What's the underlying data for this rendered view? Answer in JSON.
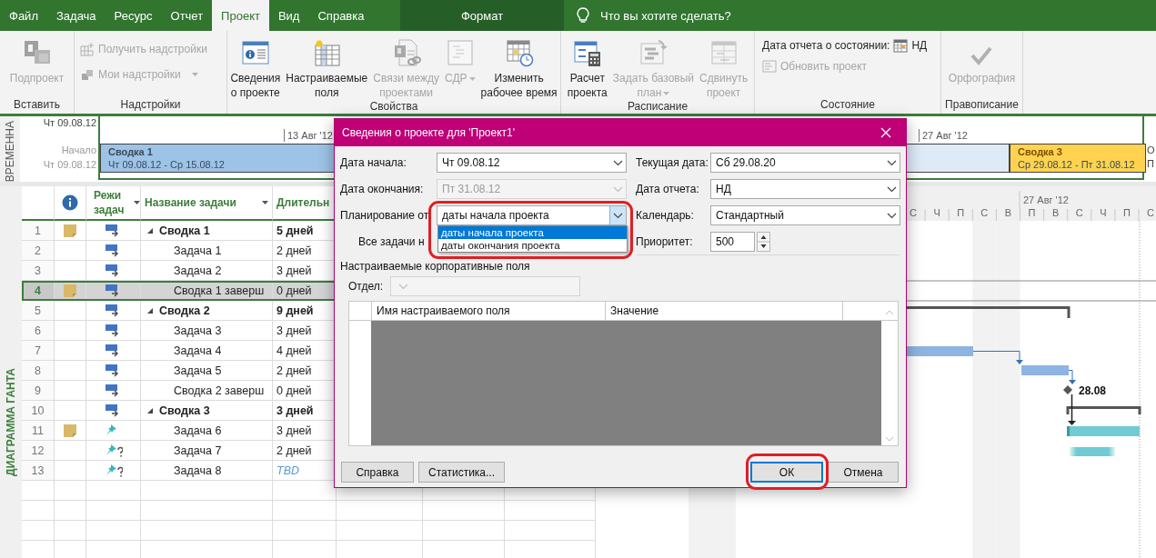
{
  "tabs": [
    {
      "label": "Файл",
      "selected": false
    },
    {
      "label": "Задача",
      "selected": false
    },
    {
      "label": "Ресурс",
      "selected": false
    },
    {
      "label": "Отчет",
      "selected": false
    },
    {
      "label": "Проект",
      "selected": true
    },
    {
      "label": "Вид",
      "selected": false
    },
    {
      "label": "Справка",
      "selected": false
    }
  ],
  "context_tab": {
    "label": "Формат"
  },
  "tell_me": {
    "placeholder": "Что вы хотите сделать?"
  },
  "ribbon": {
    "groups": [
      {
        "label": "Вставить",
        "items": [
          {
            "kind": "large",
            "label": "Подпроект",
            "disabled": true,
            "dropdown": false
          }
        ]
      },
      {
        "label": "Надстройки",
        "items": [
          {
            "kind": "small",
            "label": "Получить надстройки",
            "disabled": true,
            "dropdown": false
          },
          {
            "kind": "small",
            "label": "Мои надстройки",
            "disabled": true,
            "dropdown": true
          }
        ]
      },
      {
        "label": "Свойства",
        "items": [
          {
            "kind": "large",
            "label": "Сведения\nо проекте",
            "disabled": false,
            "dropdown": false
          },
          {
            "kind": "large",
            "label": "Настраиваемые\nполя",
            "disabled": false,
            "dropdown": false
          },
          {
            "kind": "large",
            "label": "Связи между\nпроектами",
            "disabled": true,
            "dropdown": false
          },
          {
            "kind": "large",
            "label": "СДР",
            "disabled": true,
            "dropdown": true
          },
          {
            "kind": "large",
            "label": "Изменить\nрабочее время",
            "disabled": false,
            "dropdown": false
          }
        ]
      },
      {
        "label": "Расписание",
        "items": [
          {
            "kind": "large",
            "label": "Расчет\nпроекта",
            "disabled": false,
            "dropdown": false
          },
          {
            "kind": "large",
            "label": "Задать базовый\nплан",
            "disabled": true,
            "dropdown": true
          },
          {
            "kind": "large",
            "label": "Сдвинуть\nпроект",
            "disabled": true,
            "dropdown": false
          }
        ]
      },
      {
        "label": "Состояние",
        "items": [
          {
            "kind": "status",
            "label": "Дата отчета о состоянии:",
            "value": "НД",
            "disabled": false,
            "dropdown": false
          },
          {
            "kind": "small",
            "label": "Обновить проект",
            "disabled": true,
            "dropdown": false
          }
        ]
      },
      {
        "label": "Правописание",
        "items": [
          {
            "kind": "large",
            "label": "Орфография",
            "disabled": true,
            "dropdown": false
          }
        ]
      }
    ]
  },
  "timeline": {
    "label": "ВРЕМЕННА",
    "top_date": "Чт 09.08.12",
    "start_caption": "Начало",
    "start_value": "Чт 09.08.12",
    "ticks": [
      "13 Авг '12",
      "27 Авг '12"
    ],
    "bars": [
      {
        "name": "Сводка 1",
        "dates": "Чт 09.08.12 - Ср 15.08.12",
        "color": "#9dc3e6"
      },
      {
        "color": "#deebf7"
      },
      {
        "name": "Сводка 3",
        "dates": "Ср 29.08.12 - Пт 31.08.12",
        "color": "#ffd34f"
      }
    ],
    "finish_caption": "О",
    "finish_value": "П"
  },
  "view_label": "ДИАГРАММА ГАНТА",
  "table": {
    "columns": [
      "Режи задач",
      "Название задачи",
      "Длительн"
    ],
    "rows": [
      {
        "num": "1",
        "name": "Сводка 1",
        "duration": "5 дней",
        "summary": true,
        "manual": false,
        "estimated": false,
        "note": true,
        "selected": false,
        "expanded": true,
        "tbd": false,
        "children": [
          {
            "num": "2",
            "name": "Задача 1",
            "duration": "2 дней",
            "summary": false,
            "manual": false,
            "estimated": false,
            "note": false,
            "selected": false,
            "tbd": false
          },
          {
            "num": "3",
            "name": "Задача 2",
            "duration": "3 дней",
            "summary": false,
            "manual": false,
            "estimated": false,
            "note": false,
            "selected": false,
            "tbd": false
          },
          {
            "num": "4",
            "name": "Сводка 1 заверш",
            "duration": "0 дней",
            "summary": false,
            "manual": false,
            "estimated": false,
            "note": true,
            "selected": true,
            "tbd": false
          }
        ]
      },
      {
        "num": "5",
        "name": "Сводка 2",
        "duration": "9 дней",
        "summary": true,
        "manual": false,
        "estimated": false,
        "note": false,
        "selected": false,
        "expanded": true,
        "tbd": false,
        "children": [
          {
            "num": "6",
            "name": "Задача 3",
            "duration": "3 дней",
            "summary": false,
            "manual": false,
            "estimated": false,
            "note": false,
            "selected": false,
            "tbd": false
          },
          {
            "num": "7",
            "name": "Задача 4",
            "duration": "4 дней",
            "summary": false,
            "manual": false,
            "estimated": false,
            "note": false,
            "selected": false,
            "tbd": false
          },
          {
            "num": "8",
            "name": "Задача 5",
            "duration": "2 дней",
            "summary": false,
            "manual": false,
            "estimated": false,
            "note": false,
            "selected": false,
            "tbd": false
          },
          {
            "num": "9",
            "name": "Сводка 2 заверш",
            "duration": "0 дней",
            "summary": false,
            "manual": false,
            "estimated": false,
            "note": false,
            "selected": false,
            "tbd": false
          }
        ]
      },
      {
        "num": "10",
        "name": "Сводка 3",
        "duration": "3 дней",
        "summary": true,
        "manual": false,
        "estimated": false,
        "note": false,
        "selected": false,
        "expanded": true,
        "tbd": false,
        "children": [
          {
            "num": "11",
            "name": "Задача 6",
            "duration": "3 дней",
            "summary": false,
            "manual": true,
            "estimated": false,
            "note": true,
            "selected": false,
            "tbd": false
          },
          {
            "num": "12",
            "name": "Задача 7",
            "duration": "2 дней",
            "summary": false,
            "manual": true,
            "estimated": true,
            "note": false,
            "selected": false,
            "tbd": false
          },
          {
            "num": "13",
            "name": "Задача 8",
            "duration": "TBD",
            "summary": false,
            "manual": true,
            "estimated": true,
            "note": false,
            "selected": false,
            "tbd": true
          }
        ]
      }
    ]
  },
  "gantt": {
    "month": "27 Авг '12",
    "days": [
      {
        "label": "С",
        "weekend": false
      },
      {
        "label": "Ч",
        "weekend": false
      },
      {
        "label": "П",
        "weekend": false
      },
      {
        "label": "С",
        "weekend": true
      },
      {
        "label": "В",
        "weekend": true
      },
      {
        "label": "П",
        "weekend": false
      },
      {
        "label": "В",
        "weekend": false
      },
      {
        "label": "С",
        "weekend": false
      },
      {
        "label": "Ч",
        "weekend": false
      },
      {
        "label": "П",
        "weekend": false
      },
      {
        "label": "С",
        "weekend": false
      }
    ],
    "milestone_label": "28.08"
  },
  "dialog": {
    "title": "Сведения о проекте для 'Проект1'",
    "left_fields": [
      {
        "label": "Дата начала:",
        "value": "Чт 09.08.12",
        "disabled": false,
        "expanded": false,
        "highlighted": false
      },
      {
        "label": "Дата окончания:",
        "value": "Пт 31.08.12",
        "disabled": true,
        "expanded": false,
        "highlighted": false
      },
      {
        "label": "Планирование от",
        "value": "даты начала проекта",
        "disabled": false,
        "expanded": true,
        "highlighted": true
      }
    ],
    "right_fields": [
      {
        "label": "Текущая дата:",
        "value": "Сб 29.08.20"
      },
      {
        "label": "Дата отчета:",
        "value": "НД"
      },
      {
        "label": "Календарь:",
        "value": "Стандартный"
      }
    ],
    "dropdown_options": [
      {
        "label": "даты начала проекта",
        "selected": true
      },
      {
        "label": "даты окончания проекта",
        "selected": false
      }
    ],
    "all_tasks_label": "Все задачи н",
    "priority": {
      "label": "Приоритет:",
      "value": "500"
    },
    "section_label": "Настраиваемые корпоративные поля",
    "department": {
      "label": "Отдел:",
      "disabled": true
    },
    "custom_table": {
      "columns": [
        "Имя настраиваемого поля",
        "Значение"
      ]
    },
    "buttons": [
      {
        "label": "Справка",
        "default": false,
        "highlighted": false
      },
      {
        "label": "Статистика...",
        "default": false,
        "highlighted": false
      },
      {
        "label": "ОК",
        "default": true,
        "highlighted": true
      },
      {
        "label": "Отмена",
        "default": false,
        "highlighted": false
      }
    ]
  }
}
